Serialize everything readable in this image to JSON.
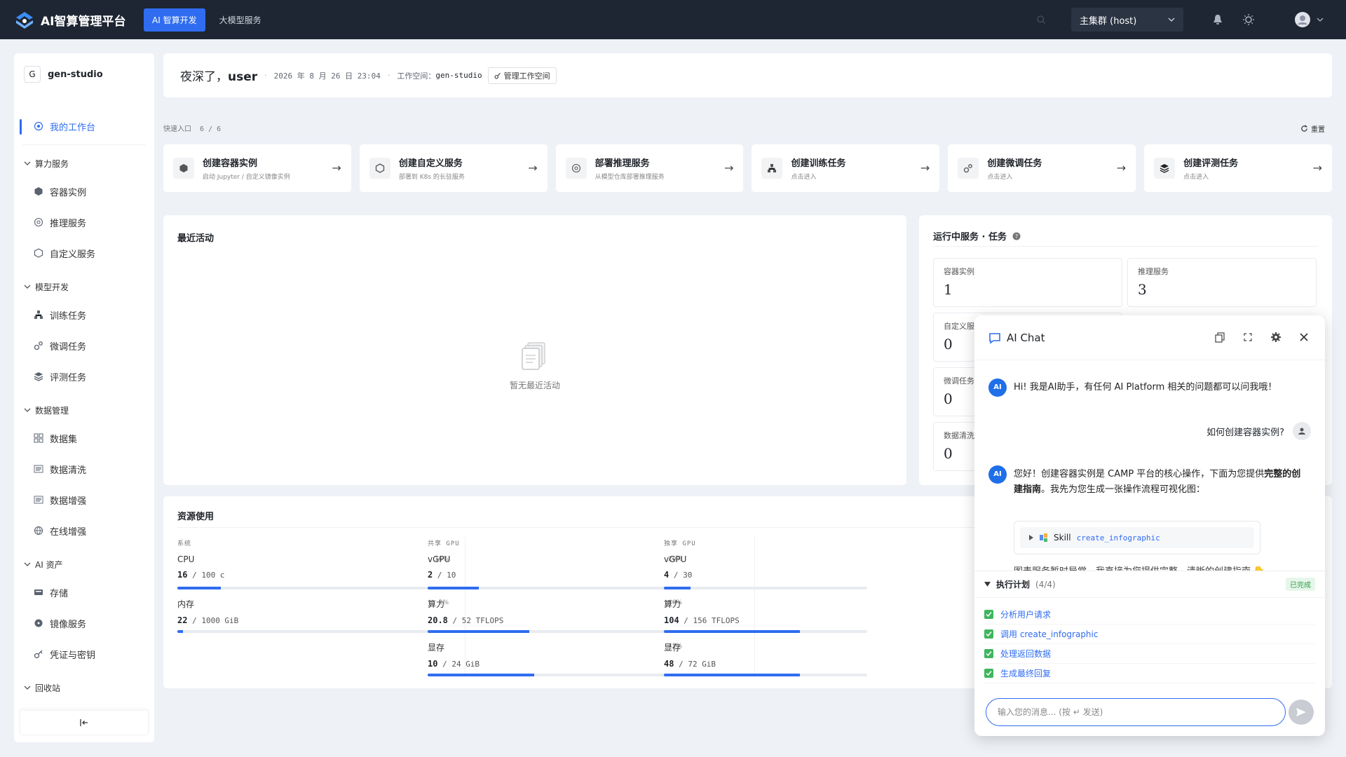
{
  "app": {
    "title": "AI智算管理平台"
  },
  "topnav": {
    "tabs": [
      {
        "label": "AI 智算开发"
      },
      {
        "label": "大模型服务"
      }
    ]
  },
  "cluster": {
    "label": "主集群 (host)"
  },
  "sidebar": {
    "workspace_letter": "G",
    "workspace_name": "gen-studio",
    "home": "我的工作台",
    "groups": [
      {
        "label": "算力服务",
        "items": [
          "容器实例",
          "推理服务",
          "自定义服务"
        ]
      },
      {
        "label": "模型开发",
        "items": [
          "训练任务",
          "微调任务",
          "评测任务"
        ]
      },
      {
        "label": "数据管理",
        "items": [
          "数据集",
          "数据清洗",
          "数据增强",
          "在线增强"
        ]
      },
      {
        "label": "AI 资产",
        "items": [
          "存储",
          "镜像服务",
          "凭证与密钥"
        ]
      },
      {
        "label": "回收站",
        "items": []
      }
    ]
  },
  "greeting": {
    "prefix": "夜深了，",
    "user": "user",
    "datetime": "2026 年 8 月 26 日 23:04",
    "workspace_label": "工作空间：",
    "workspace_value": "gen-studio",
    "manage_label": "管理工作空间"
  },
  "quick": {
    "label": "快速入口",
    "count": "6 / 6",
    "reset": "重置",
    "cards": [
      {
        "title": "创建容器实例",
        "sub": "启动 Jupyter / 自定义镜像实例"
      },
      {
        "title": "创建自定义服务",
        "sub": "部署到 K8s 的长驻服务"
      },
      {
        "title": "部署推理服务",
        "sub": "从模型仓库部署推理服务"
      },
      {
        "title": "创建训练任务",
        "sub": "点击进入"
      },
      {
        "title": "创建微调任务",
        "sub": "点击进入"
      },
      {
        "title": "创建评测任务",
        "sub": "点击进入"
      }
    ],
    "arrow": "→"
  },
  "activity": {
    "title": "最近活动",
    "empty": "暂无最近活动"
  },
  "running": {
    "title": "运行中服务 · 任务",
    "stats": [
      {
        "label": "容器实例",
        "value": "1"
      },
      {
        "label": "推理服务",
        "value": "3"
      },
      {
        "label": "自定义服务",
        "value": "0"
      },
      {
        "label": "微调任务",
        "value": "0"
      },
      {
        "label": "数据清洗",
        "value": "0"
      }
    ]
  },
  "resources": {
    "title": "资源使用",
    "columns": [
      {
        "caption": "系统",
        "metrics": [
          {
            "name": "CPU",
            "pct": "16%",
            "value": "16",
            "total": " / 100 c",
            "fill": 0.16
          },
          {
            "name": "内存",
            "pct": "2%",
            "value": "22",
            "total": " / 1000 GiB",
            "fill": 0.02
          }
        ]
      },
      {
        "caption": "共享 GPU",
        "metrics": [
          {
            "name": "vGPU",
            "pct": "20%",
            "value": "2",
            "total": " / 10",
            "fill": 0.2
          },
          {
            "name": "算力",
            "pct": "40%",
            "value": "20.8",
            "total": " / 52 TFLOPS",
            "fill": 0.4
          },
          {
            "name": "显存",
            "pct": "42%",
            "value": "10",
            "total": " / 24 GiB",
            "fill": 0.42
          }
        ]
      },
      {
        "caption": "独享 GPU",
        "metrics": [
          {
            "name": "vGPU",
            "pct": "",
            "value": "4",
            "total": " / 30",
            "fill": 0.13
          },
          {
            "name": "算力",
            "pct": "",
            "value": "104",
            "total": " / 156 TFLOPS",
            "fill": 0.67
          },
          {
            "name": "显存",
            "pct": "",
            "value": "48",
            "total": " / 72 GiB",
            "fill": 0.67
          }
        ]
      }
    ]
  },
  "chat": {
    "title": "AI Chat",
    "ai_badge": "AI",
    "greeting": "Hi! 我是AI助手，有任何 AI Platform 相关的问题都可以问我哦！",
    "user_message": "如何创建容器实例?",
    "reply_part1": "您好！创建容器实例是 CAMP 平台的核心操作，下面为您提供",
    "reply_bold": "完整的创建指南",
    "reply_part2": "。我先为您生成一张操作流程可视化图：",
    "skill_label": "Skill",
    "skill_name": "create_infographic",
    "cut_text": "图表服务暂时异常，我直接为您提供完整、清晰的创建指南 👇",
    "plan_title": "执行计划",
    "plan_count": "(4/4)",
    "plan_status": "已完成",
    "plan_steps": [
      "分析用户请求",
      "调用 create_infographic",
      "处理返回数据",
      "生成最终回复"
    ],
    "input_placeholder": "输入您的消息... (按 ↵ 发送)"
  }
}
